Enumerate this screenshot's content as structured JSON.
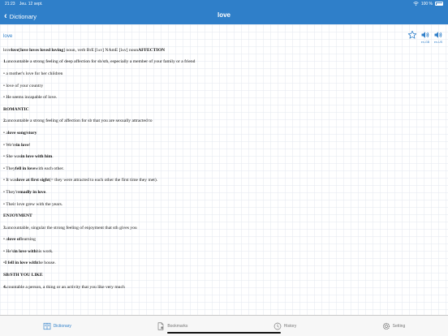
{
  "status": {
    "time": "21:23",
    "date": "Jeu. 12 sept.",
    "battery": "100 %"
  },
  "nav": {
    "back_label": "Dictionary",
    "title": "love"
  },
  "word": {
    "link": "love"
  },
  "actions": {
    "us_label": "en-US",
    "gb_label": "en-GB"
  },
  "entry": {
    "l0": {
      "a": "love ",
      "b": "love",
      "c": " [",
      "d": "love loves loved loving",
      "e": "] noun, verb BrE [lʌv] NAmE [lʌv] noun   ",
      "f": "AFFECTION"
    },
    "l1": {
      "a": "1.",
      "b": " uncountable a strong feeling of deep affection for sb/sth, especially a member of your family or a friend"
    },
    "l2": {
      "a": "• a mother's love for her children"
    },
    "l3": {
      "a": "• love of your country"
    },
    "l4": {
      "a": "• He seems incapable of love."
    },
    "l5": {
      "a": "ROMANTIC"
    },
    "l6": {
      "a": "2.",
      "b": " uncountable a strong feeling of affection for sb that you are sexually attracted to"
    },
    "l7": {
      "a": "• a ",
      "b": "love song/story"
    },
    "l8": {
      "a": "• We're ",
      "b": "in love",
      "c": "!"
    },
    "l9": {
      "a": "• She was ",
      "b": "in love with him",
      "c": "."
    },
    "l10": {
      "a": "• They ",
      "b": "fell in love",
      "c": " with each other."
    },
    "l11": {
      "a": "• It was ",
      "b": "love at first sight",
      "c": " (= they were attracted to each other the first time they met)."
    },
    "l12": {
      "a": "• They're ",
      "b": "madly in love",
      "c": "."
    },
    "l13": {
      "a": "• Their love grew with the years."
    },
    "l14": {
      "a": "ENJOYMENT"
    },
    "l15": {
      "a": "3.",
      "b": " uncountable, singular the strong feeling of enjoyment that sth gives you"
    },
    "l16": {
      "a": "• a ",
      "b": "love of",
      "c": " learning"
    },
    "l17": {
      "a": "• He's ",
      "b": "in love with",
      "c": " his work."
    },
    "l18": {
      "a": "• ",
      "b": "I fell in love with",
      "c": " the house."
    },
    "l19": {
      "a": "SB/STH YOU LIKE"
    },
    "l20": {
      "a": "4.",
      "b": " countable a person, a thing or an activity that you like very much"
    }
  },
  "tabs": {
    "dictionary": "Dictionary",
    "bookmarks": "Bookmarks",
    "history": "History",
    "setting": "Setting"
  },
  "colors": {
    "accent": "#2f7fc9",
    "tab_inactive": "#777777"
  }
}
